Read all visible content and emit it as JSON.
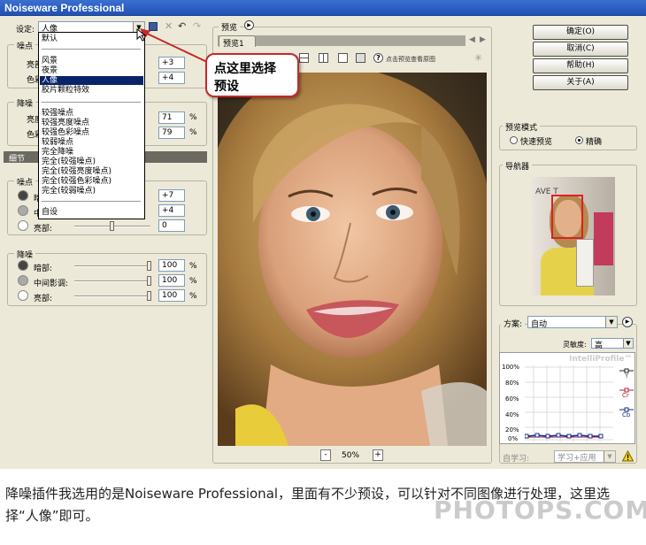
{
  "window": {
    "title": "Noiseware Professional"
  },
  "left": {
    "setting_label": "设定:",
    "preset_value": "人像",
    "section_noise_level": "噪点",
    "level_rows": [
      {
        "label": "亮部",
        "value": "+3"
      },
      {
        "label": "色彩",
        "value": "+4"
      }
    ],
    "section_reduce": "降噪",
    "reduce_rows": [
      {
        "label": "亮度",
        "value": "71",
        "unit": "%"
      },
      {
        "label": "色彩",
        "value": "79",
        "unit": "%"
      }
    ],
    "detail_tab": "细节",
    "detail_noise_group": "噪点",
    "detail_rows": [
      {
        "label": "暗部:",
        "value": "+7"
      },
      {
        "label": "中",
        "value": "+4"
      },
      {
        "label": "亮部:",
        "value": "0"
      }
    ],
    "detail_reduce_group": "降噪",
    "detail_reduce_rows": [
      {
        "label": "暗部:",
        "value": "100",
        "unit": "%"
      },
      {
        "label": "中间影调:",
        "value": "100",
        "unit": "%"
      },
      {
        "label": "亮部:",
        "value": "100",
        "unit": "%"
      }
    ]
  },
  "dropdown": {
    "items": [
      "默认",
      "风景",
      "夜景",
      "人像",
      "胶片颗粒特效",
      "较强噪点",
      "较强亮度噪点",
      "较强色彩噪点",
      "较弱噪点",
      "完全降噪",
      "完全(较强噪点)",
      "完全(较强亮度噪点)",
      "完全(较强色彩噪点)",
      "完全(较弱噪点)",
      "自设"
    ],
    "selected": "人像"
  },
  "callout": {
    "line1": "点这里选择",
    "line2": "预设"
  },
  "preview": {
    "label": "预览",
    "tab": "预览1",
    "hint": "点击预览查看原图",
    "zoom": "50%",
    "zoom_out": "-",
    "zoom_in": "+"
  },
  "right": {
    "buttons": [
      "确定(O)",
      "取消(C)",
      "帮助(H)",
      "关于(A)"
    ],
    "preview_mode_label": "预览模式",
    "mode_fast": "快速预览",
    "mode_accurate": "精确",
    "navigator_label": "导航器",
    "navigator_banner": "AVE T",
    "scheme_label": "方案:",
    "scheme_value": "自动",
    "sensitivity_label": "灵敏度:",
    "sensitivity_value": "高",
    "graph_brand": "IntelliProfile™",
    "graph_ticks": [
      "100%",
      "80%",
      "60%",
      "40%",
      "20%",
      "0%"
    ],
    "graph_legend": [
      "Y",
      "Cr",
      "Cb"
    ],
    "learn_label": "自学习:",
    "learn_value": "学习+应用"
  },
  "caption": "降噪插件我选用的是Noiseware Professional，里面有不少预设，可以针对不同图像进行处理，这里选择“人像”即可。",
  "watermark": "PHOTOPS.COM",
  "colors": {
    "title_blue": "#2151b4",
    "callout_red": "#c62828",
    "selection": "#0a246a"
  }
}
